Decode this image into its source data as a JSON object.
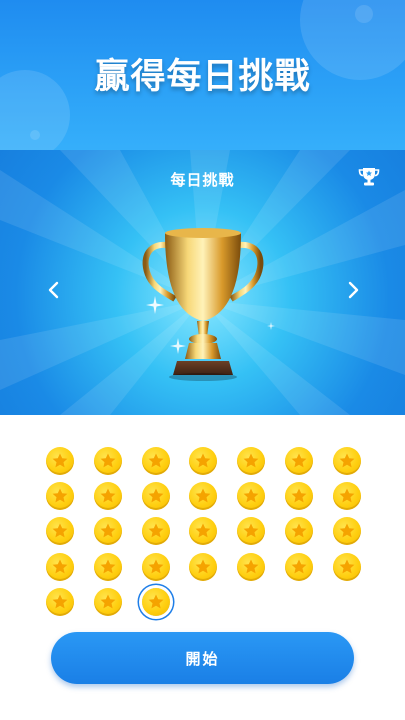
{
  "banner": {
    "title": "贏得每日挑戰"
  },
  "hero": {
    "title": "每日挑戰",
    "trophy_icon": "trophy-icon",
    "prev_icon": "chevron-left-icon",
    "next_icon": "chevron-right-icon"
  },
  "coins": {
    "total": 31,
    "columns": 7,
    "current_index": 30,
    "icon": "star-coin-icon"
  },
  "start_button": {
    "label": "開始"
  },
  "colors": {
    "banner": "#2da3f7",
    "coin": "#ffcf10",
    "star": "#f5a300",
    "button": "#1a7fe6",
    "highlight_ring": "#1e7ee8"
  }
}
